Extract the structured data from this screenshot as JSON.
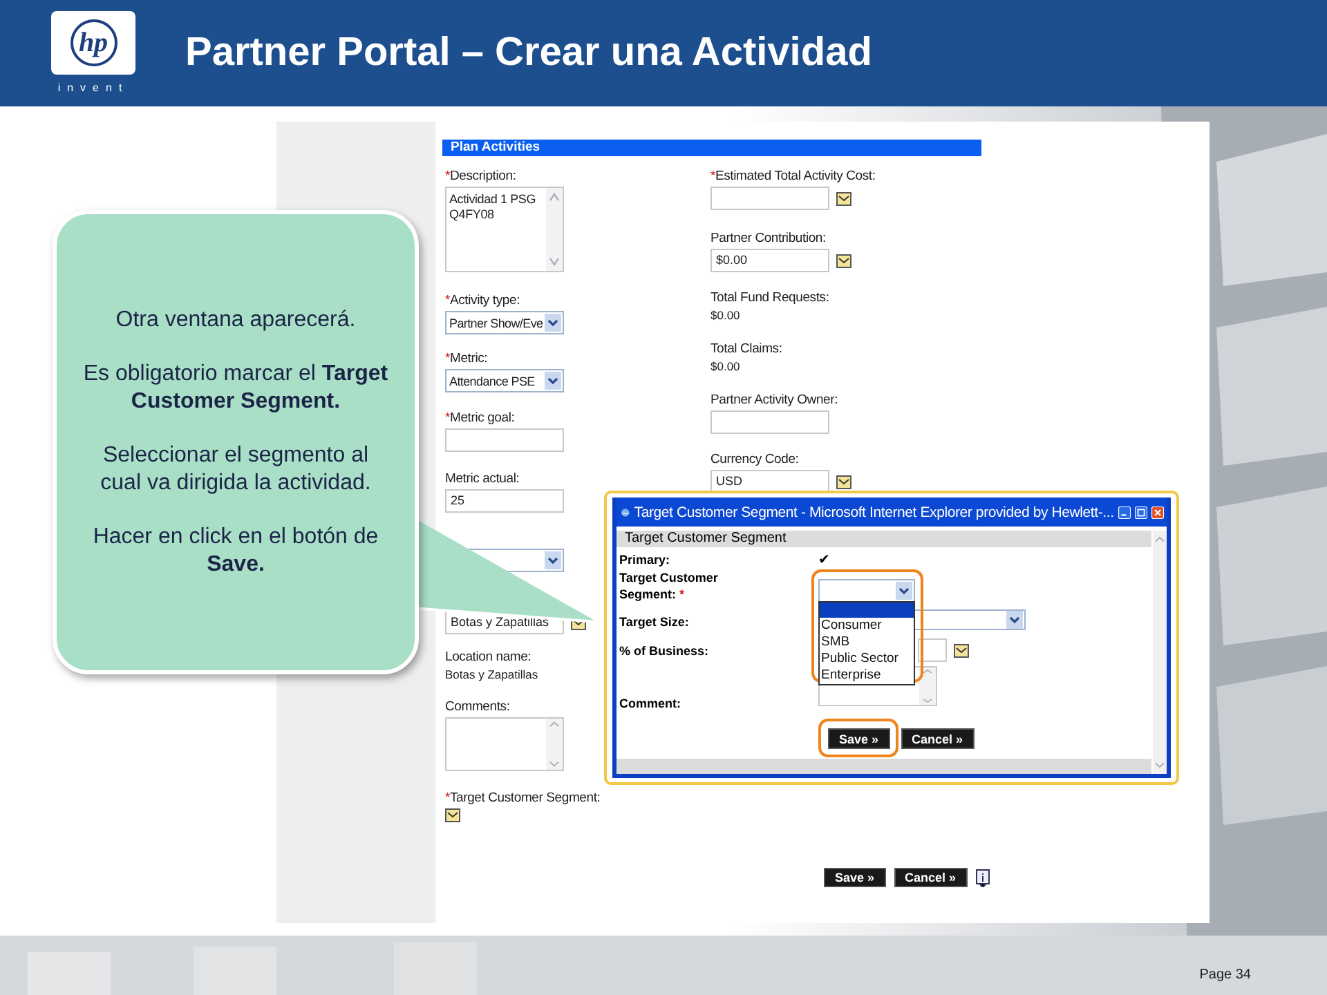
{
  "slide": {
    "logo": {
      "mark": "hp",
      "tagline": "invent"
    },
    "title": "Partner Portal – Crear una Actividad",
    "page": "Page 34"
  },
  "callout": {
    "paragraphs": [
      "Otra ventana aparecerá.",
      "Es obligatorio marcar el **Target Customer Segment.**",
      "Seleccionar el segmento al cual va dirigida la actividad.",
      "Hacer en click en el botón de **Save.**"
    ]
  },
  "form": {
    "section_title": "Plan Activities",
    "left_fields": [
      {
        "kind": "textarea",
        "required_mark": "*",
        "label": "Description:",
        "value": "Actividad 1 PSG\nQ4FY08"
      },
      {
        "kind": "select",
        "required_mark": "*",
        "label": "Activity type:",
        "value": "Partner Show/Eve"
      },
      {
        "kind": "select",
        "required_mark": "*",
        "label": "Metric:",
        "value": "Attendance PSE"
      },
      {
        "kind": "input",
        "required_mark": "*",
        "label": "Metric goal:"
      },
      {
        "kind": "input",
        "label": "Metric actual:",
        "value": "25"
      },
      {
        "kind": "select"
      },
      {
        "kind": "input",
        "value": "Botas y Zapatillas",
        "lookup": true
      },
      {
        "kind": "text",
        "label": "Location name:",
        "value": "Botas y Zapatillas"
      },
      {
        "kind": "textarea",
        "label": "Comments:"
      },
      {
        "kind": "lookup",
        "required_mark": "*",
        "label": "Target Customer Segment:"
      }
    ],
    "right_fields": [
      {
        "kind": "input",
        "required_mark": "*",
        "label": "Estimated Total Activity Cost:",
        "lookup": true
      },
      {
        "kind": "input",
        "label": "Partner Contribution:",
        "value": "$0.00",
        "lookup": true
      },
      {
        "kind": "text",
        "label": "Total Fund Requests:",
        "value": "$0.00"
      },
      {
        "kind": "text",
        "label": "Total Claims:",
        "value": "$0.00"
      },
      {
        "kind": "input",
        "label": "Partner Activity Owner:"
      },
      {
        "kind": "input",
        "label": "Currency Code:",
        "value": "USD",
        "lookup": true
      }
    ],
    "buttons": [
      "Save »",
      "Cancel »"
    ]
  },
  "popup": {
    "title": "Target Customer Segment - Microsoft Internet Explorer provided by Hewlett-...",
    "section": "Target Customer Segment",
    "rows": [
      {
        "kind": "check",
        "label": "Primary:",
        "value": "✔"
      },
      {
        "kind": "dropdown",
        "label": "Target Customer Segment:",
        "required_mark": "*",
        "highlighted": true,
        "options": [
          {
            "kind": "blank",
            "selected": true
          },
          {
            "label": "Consumer",
            "selected": false
          },
          {
            "label": "SMB",
            "selected": false
          },
          {
            "label": "Public Sector",
            "selected": false
          },
          {
            "label": "Enterprise",
            "selected": false
          }
        ]
      },
      {
        "kind": "select",
        "label": "Target Size:"
      },
      {
        "kind": "input",
        "label": "% of Business:"
      },
      {
        "kind": "textarea",
        "label": "Comment:"
      }
    ],
    "buttons": [
      {
        "label": "Save »",
        "highlighted": true
      },
      {
        "label": "Cancel »",
        "highlighted": false
      }
    ]
  }
}
